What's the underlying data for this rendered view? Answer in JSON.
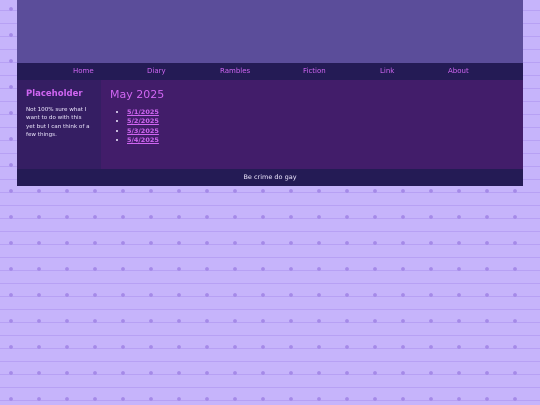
{
  "nav": {
    "items": [
      {
        "label": "Home"
      },
      {
        "label": "Diary"
      },
      {
        "label": "Rambles"
      },
      {
        "label": "Fiction"
      },
      {
        "label": "Link"
      },
      {
        "label": "About"
      }
    ]
  },
  "sidebar": {
    "title": "Placeholder",
    "text": "Not 100% sure what I want to do with this yet but I can think of a few things."
  },
  "main": {
    "title": "May 2025",
    "posts": [
      {
        "label": "5/1/2025"
      },
      {
        "label": "5/2/2025"
      },
      {
        "label": "5/3/2025"
      },
      {
        "label": "5/4/2025"
      }
    ]
  },
  "footer": {
    "text": "Be crime do gay"
  },
  "colors": {
    "background": "#c6b4fb",
    "banner": "#5b4d9a",
    "nav_bar": "#241b55",
    "sidebar": "#351e63",
    "main_panel": "#421d6a",
    "accent_pink": "#d066f2",
    "text_light": "#efe9ff"
  }
}
